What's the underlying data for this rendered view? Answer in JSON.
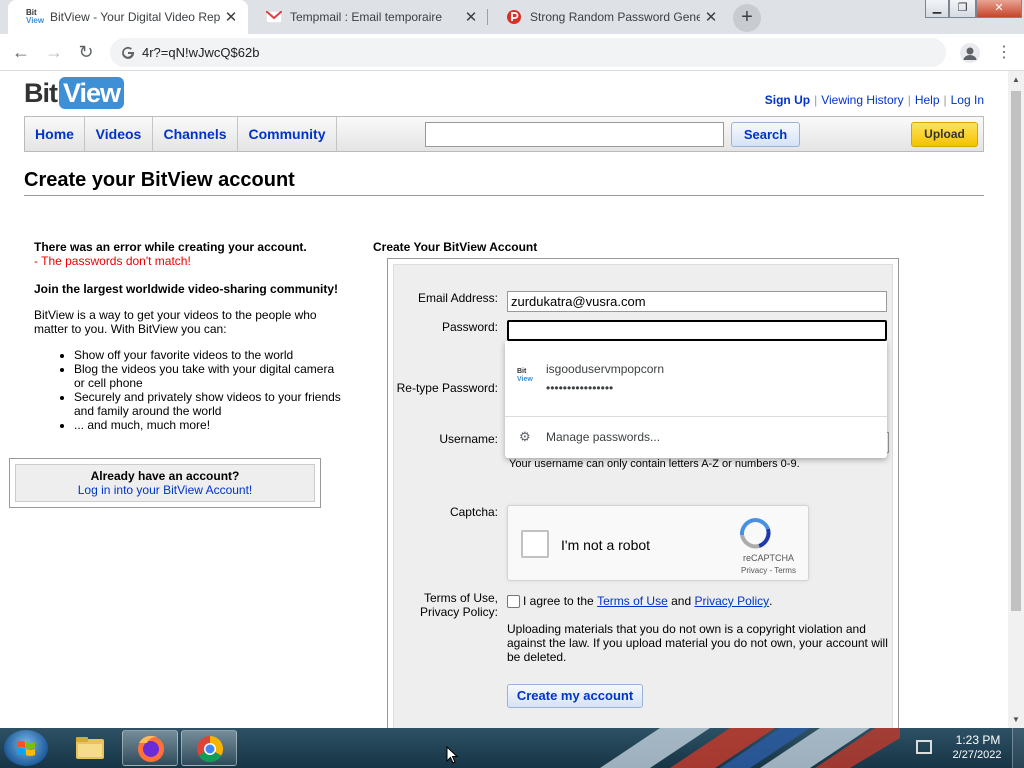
{
  "browser": {
    "tabs": [
      {
        "title": "BitView - Your Digital Video Repo",
        "favicon": "bitview-icon"
      },
      {
        "title": "Tempmail : Email temporaire",
        "favicon": "gmail-icon"
      },
      {
        "title": "Strong Random Password Genera",
        "favicon": "password-icon"
      }
    ],
    "new_tab": "+",
    "url": "4r?=qN!wJwcQ$62b"
  },
  "site": {
    "logo_bit": "Bit",
    "logo_view": "View",
    "toplinks": {
      "signup": "Sign Up",
      "history": "Viewing History",
      "help": "Help",
      "login": "Log In"
    },
    "nav": [
      "Home",
      "Videos",
      "Channels",
      "Community"
    ],
    "search_label": "Search",
    "upload_label": "Upload"
  },
  "page": {
    "title": "Create your BitView account",
    "error_title": "There was an error while creating your account.",
    "error_detail": "- The passwords don't match!",
    "join_heading": "Join the largest worldwide video-sharing community!",
    "intro": "BitView is a way to get your videos to the people who matter to you. With BitView you can:",
    "bullets": [
      "Show off your favorite videos to the world",
      "Blog the videos you take with your digital camera or cell phone",
      "Securely and privately show videos to your friends and family around the world",
      "... and much, much more!"
    ],
    "already_q": "Already have an account?",
    "already_link": "Log in into your BitView Account!"
  },
  "form": {
    "heading": "Create Your BitView Account",
    "email_label": "Email Address:",
    "email_value": "zurdukatra@vusra.com",
    "password_label": "Password:",
    "retype_label": "Re-type Password:",
    "username_label": "Username:",
    "username_hint": "Your username can only contain letters A-Z or numbers 0-9.",
    "captcha_label": "Captcha:",
    "captcha_text": "I'm not a robot",
    "captcha_brand": "reCAPTCHA",
    "captcha_terms": "Privacy - Terms",
    "terms_label_1": "Terms of Use,",
    "terms_label_2": "Privacy Policy:",
    "agree_prefix": "I agree to the",
    "agree_terms": "Terms of Use",
    "agree_and": "and",
    "agree_privacy": "Privacy Policy",
    "agree_end": ".",
    "warning": "Uploading materials that you do not own is a copyright violation and against the law. If you upload material you do not own, your account will be deleted.",
    "submit": "Create my account"
  },
  "password_popup": {
    "username": "isgooduservmpopcorn",
    "masked": "••••••••••••••••",
    "icon_label_1": "Bit",
    "icon_label_2": "View",
    "manage": "Manage passwords..."
  },
  "taskbar": {
    "time": "1:23 PM",
    "date": "2/27/2022",
    "apps": [
      "explorer-icon",
      "firefox-icon",
      "chrome-icon"
    ]
  }
}
